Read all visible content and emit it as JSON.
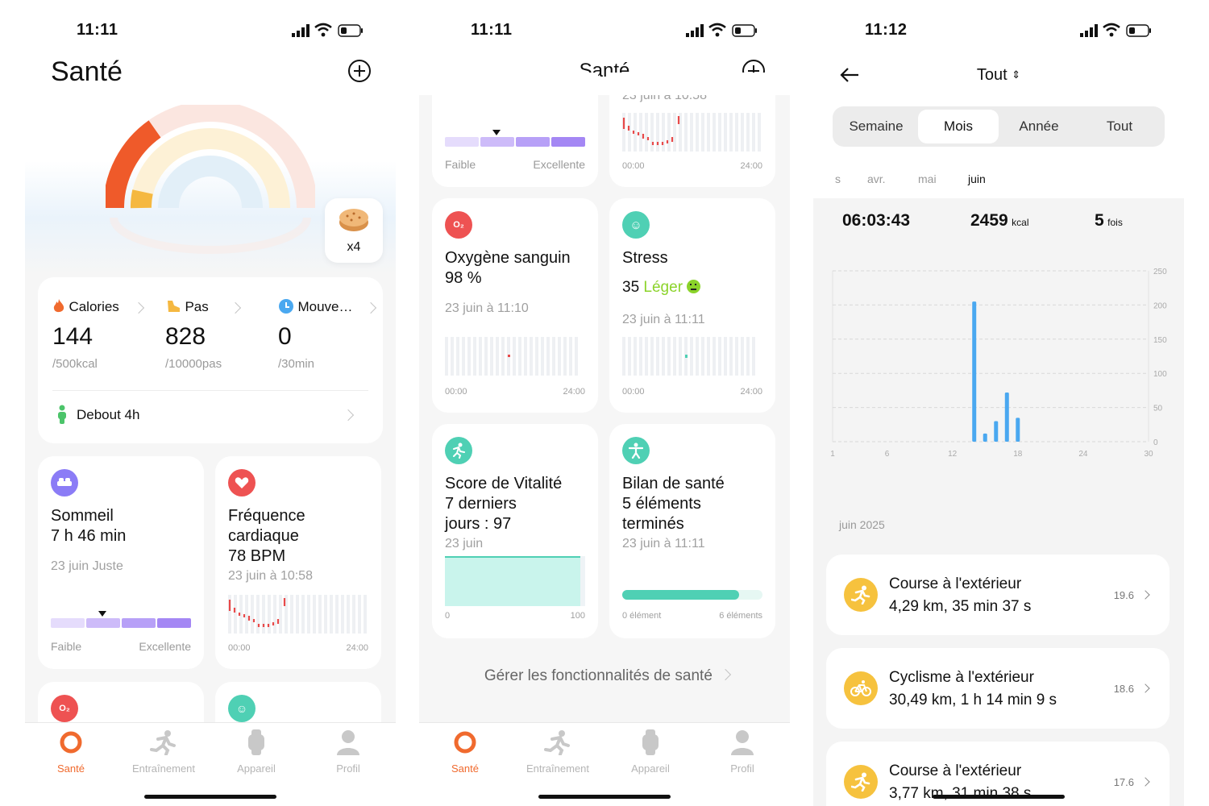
{
  "status": {
    "time1": "11:11",
    "time2": "11:11",
    "time3": "11:12"
  },
  "screen1": {
    "title": "Santé",
    "biscuit_count": "x4",
    "activity": {
      "calories": {
        "label": "Calories",
        "value": "144",
        "goal": "/500kcal"
      },
      "steps": {
        "label": "Pas",
        "value": "828",
        "goal": "/10000pas"
      },
      "movement": {
        "label": "Mouve…",
        "value": "0",
        "goal": "/30min"
      },
      "standing": "Debout 4h"
    },
    "sleep": {
      "title1": "Sommeil",
      "title2": "7 h 46 min",
      "date": "23 juin Juste",
      "low": "Faible",
      "high": "Excellente"
    },
    "heart": {
      "title1": "Fréquence",
      "title2": "cardiaque",
      "title3": "78 BPM",
      "date": "23 juin à 10:58",
      "start": "00:00",
      "end": "24:00"
    }
  },
  "screen2": {
    "title": "Santé",
    "partial_date": "23 juin à 10:58",
    "sleep_low": "Faible",
    "sleep_high": "Excellente",
    "hr_start": "00:00",
    "hr_end": "24:00",
    "oxygen": {
      "title": "Oxygène sanguin",
      "value": "98 %",
      "date": "23 juin à 11:10",
      "start": "00:00",
      "end": "24:00"
    },
    "stress": {
      "title": "Stress",
      "value": "35",
      "level": "Léger",
      "date": "23 juin à 11:11",
      "start": "00:00",
      "end": "24:00"
    },
    "vitality": {
      "line1": "Score de Vitalité",
      "line2": "7 derniers",
      "line3": "jours : 97",
      "date": "23 juin",
      "min": "0",
      "max": "100",
      "score": 97
    },
    "checkup": {
      "line1": "Bilan de santé",
      "line2": "5 éléments",
      "line3": "terminés",
      "date": "23 juin à 11:11",
      "min": "0 élément",
      "max": "6 éléments",
      "done": 5,
      "total": 6
    },
    "manage": "Gérer les fonctionnalités de santé"
  },
  "tabs": [
    {
      "label": "Santé",
      "icon": "health-ring-icon"
    },
    {
      "label": "Entraînement",
      "icon": "runner-icon"
    },
    {
      "label": "Appareil",
      "icon": "watch-icon"
    },
    {
      "label": "Profil",
      "icon": "person-icon"
    }
  ],
  "screen3": {
    "filter": "Tout",
    "periods": [
      "Semaine",
      "Mois",
      "Année",
      "Tout"
    ],
    "selected_period": "Mois",
    "months": [
      "s",
      "avr.",
      "mai",
      "juin"
    ],
    "summary": {
      "duration": "06:03:43",
      "kcal": "2459",
      "kcal_unit": "kcal",
      "count": "5",
      "count_unit": "fois"
    },
    "section": "juin 2025",
    "activities": [
      {
        "title": "Course à l'extérieur",
        "detail": "4,29 km, 35 min 37 s",
        "date": "19.6",
        "icon": "run-icon"
      },
      {
        "title": "Cyclisme à l'extérieur",
        "detail": "30,49 km, 1 h 14 min 9 s",
        "date": "18.6",
        "icon": "bike-icon"
      },
      {
        "title": "Course à l'extérieur",
        "detail": "3,77 km, 31 min 38 s",
        "date": "17.6",
        "icon": "run-icon"
      }
    ]
  },
  "chart_data": {
    "type": "bar",
    "x": [
      14,
      15,
      16,
      17,
      18
    ],
    "values": [
      205,
      12,
      30,
      72,
      35
    ],
    "xticks": [
      "1",
      "6",
      "12",
      "18",
      "24",
      "30"
    ],
    "yticks": [
      "0",
      "50",
      "100",
      "150",
      "200",
      "250"
    ],
    "xlim": [
      1,
      30
    ],
    "ylim": [
      0,
      250
    ],
    "color": "#4aa8f0",
    "grid": true
  },
  "colors": {
    "accent": "#f06a2e",
    "teal": "#4fd0b4",
    "purple": "#a78bfa",
    "red": "#e84a4a",
    "yellow": "#f6c23e"
  }
}
